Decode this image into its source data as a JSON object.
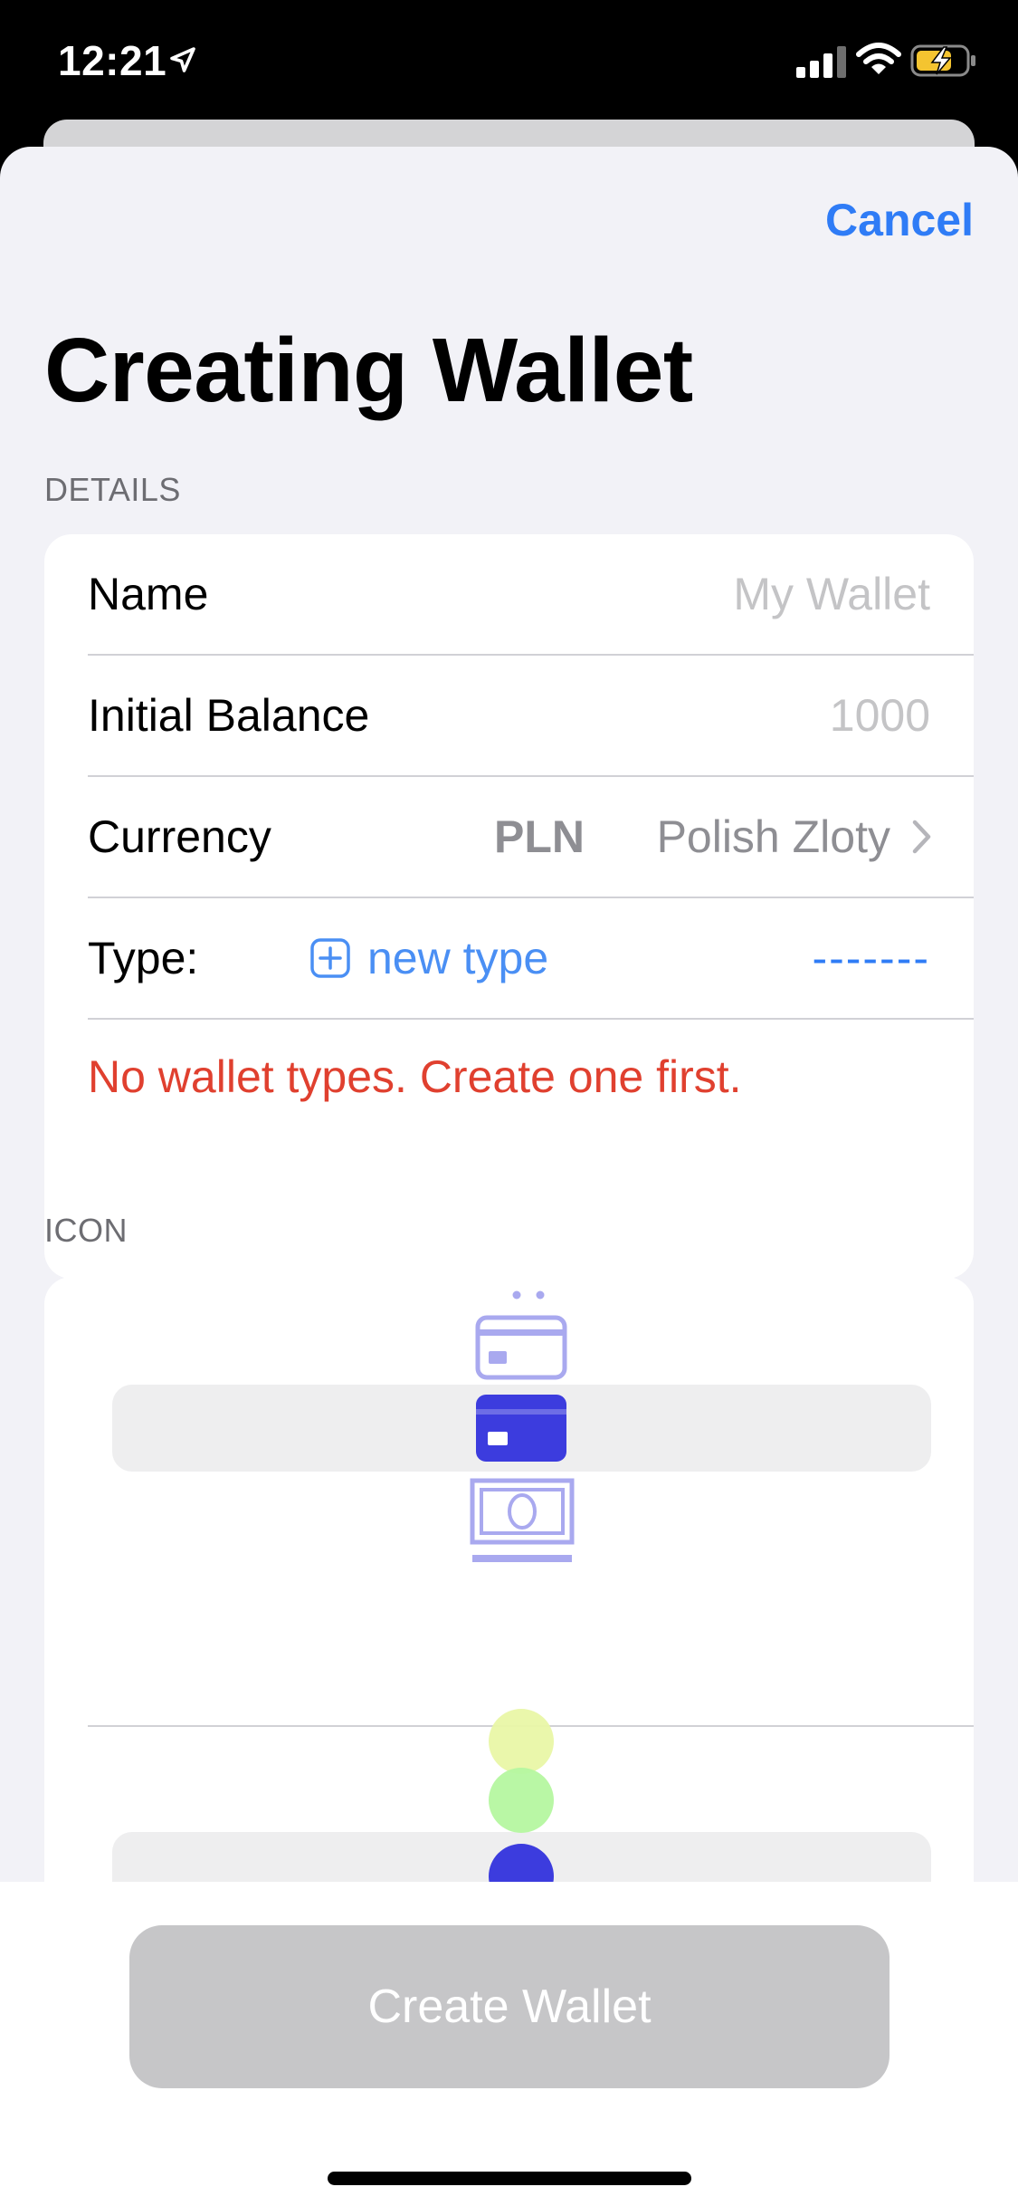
{
  "status_bar": {
    "time": "12:21",
    "icons": [
      "location-arrow-icon",
      "cellular-signal-icon",
      "wifi-icon",
      "battery-charging-icon"
    ]
  },
  "nav": {
    "cancel_label": "Cancel",
    "title": "Creating Wallet"
  },
  "details": {
    "header": "DETAILS",
    "name": {
      "label": "Name",
      "placeholder": "My Wallet",
      "value": ""
    },
    "initial_balance": {
      "label": "Initial Balance",
      "placeholder": "1000",
      "value": ""
    },
    "currency": {
      "label": "Currency",
      "code": "PLN",
      "name": "Polish Zloty"
    },
    "type": {
      "label": "Type:",
      "new_type_label": "new type",
      "selected": "-------"
    },
    "error": "No wallet types. Create one first."
  },
  "icon_section": {
    "header": "ICON",
    "icon_options": [
      "wallet-icon",
      "credit-card-icon",
      "credit-card-icon",
      "banknote-icon"
    ],
    "selected_icon": "credit-card-icon",
    "color_options": [
      "#e9f7a6",
      "#b5f7a0",
      "#3c3cde",
      "#b2f5f5",
      "#d7b3f4"
    ],
    "selected_color": "#3c3cde"
  },
  "footer": {
    "create_label": "Create Wallet",
    "enabled": false
  }
}
